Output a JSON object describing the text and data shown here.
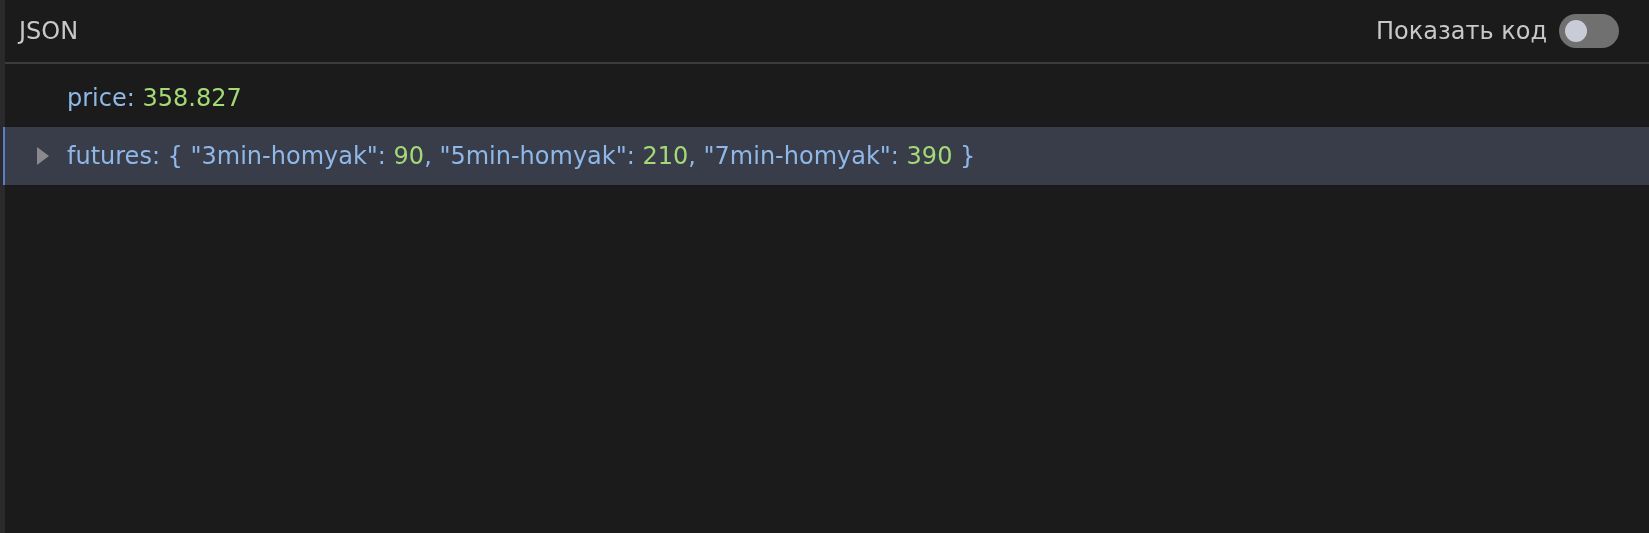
{
  "header": {
    "title": "JSON",
    "toggle": {
      "label": "Показать код",
      "on": false
    }
  },
  "rows": [
    {
      "kind": "leaf",
      "selected": false,
      "segments": [
        {
          "kind": "key",
          "text": "price: "
        },
        {
          "kind": "number",
          "text": "358.827"
        }
      ]
    },
    {
      "kind": "object",
      "expanded": false,
      "selected": true,
      "segments": [
        {
          "kind": "key",
          "text": "futures: "
        },
        {
          "kind": "punct",
          "text": "{ \"3min-homyak\": "
        },
        {
          "kind": "number",
          "text": "90"
        },
        {
          "kind": "punct",
          "text": ", \"5min-homyak\": "
        },
        {
          "kind": "number",
          "text": "210"
        },
        {
          "kind": "punct",
          "text": ", \"7min-homyak\": "
        },
        {
          "kind": "number",
          "text": "390"
        },
        {
          "kind": "punct",
          "text": " }"
        }
      ]
    }
  ]
}
